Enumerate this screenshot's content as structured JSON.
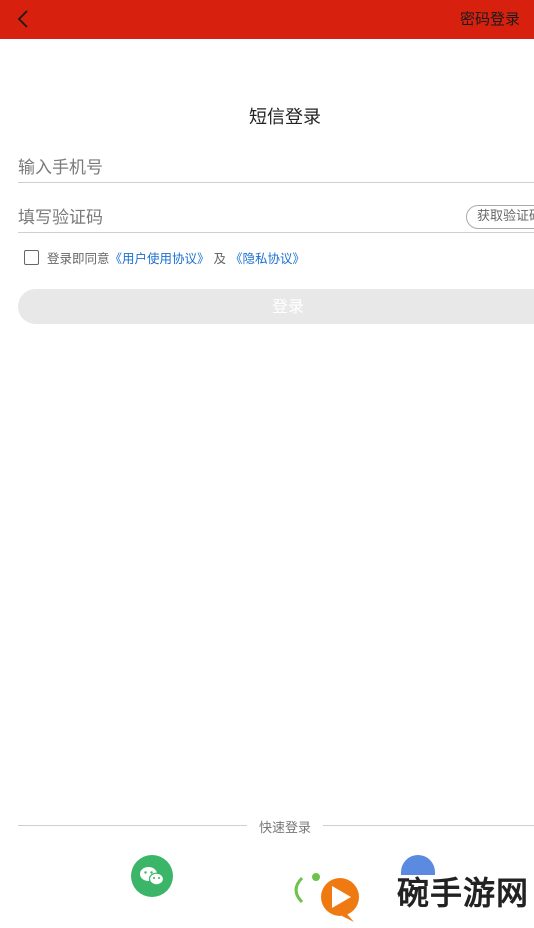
{
  "header": {
    "password_login": "密码登录"
  },
  "main": {
    "title": "短信登录",
    "phone_placeholder": "输入手机号",
    "code_placeholder": "填写验证码",
    "get_code": "获取验证码",
    "agreement": {
      "prefix": "登录即同意",
      "user_agreement": "《用户使用协议》",
      "and": "及",
      "privacy": "《隐私协议》"
    },
    "login_button": "登录"
  },
  "quick_login": {
    "label": "快速登录"
  },
  "watermark": {
    "text": "碗手游网"
  },
  "colors": {
    "header_bg": "#d8200f",
    "link": "#1a6fd1",
    "wechat": "#3bb567",
    "qq": "#5a8be0",
    "watermark_orange": "#f07a12",
    "watermark_green": "#6cc24a"
  }
}
